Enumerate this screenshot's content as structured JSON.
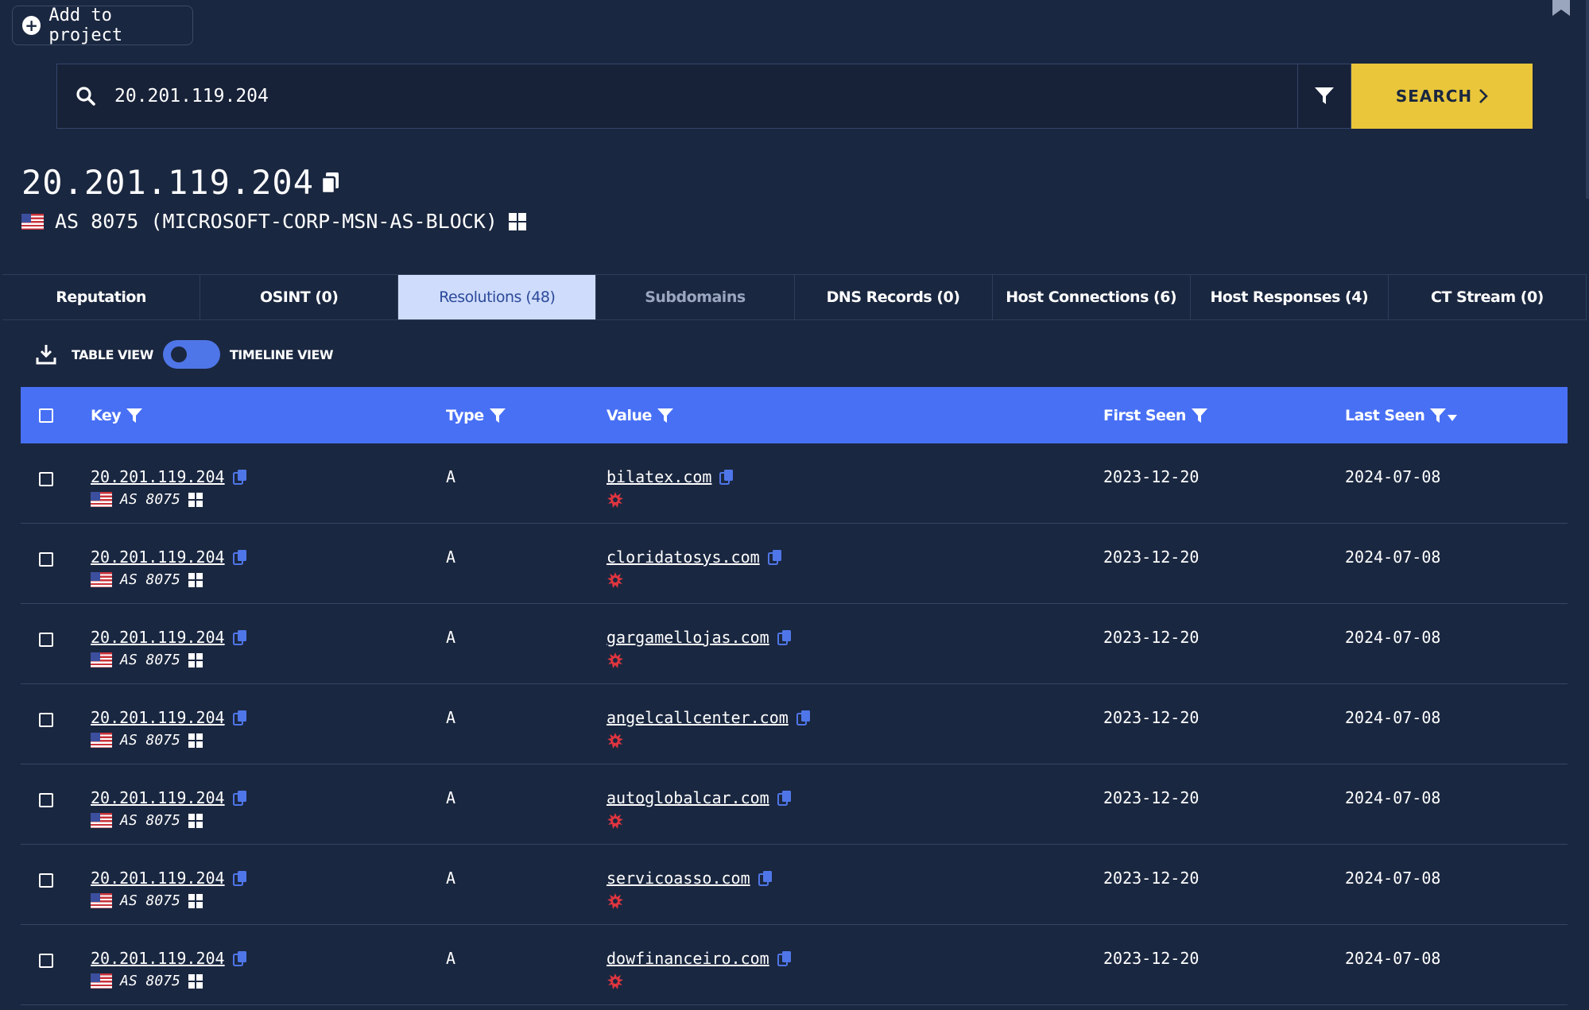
{
  "toolbar": {
    "add_to_project_label": "Add to project"
  },
  "search": {
    "value": "20.201.119.204",
    "button_label": "SEARCH"
  },
  "header": {
    "ip": "20.201.119.204",
    "as_label": "AS 8075 (MICROSOFT-CORP-MSN-AS-BLOCK)"
  },
  "tabs": [
    {
      "label": "Reputation",
      "state": "normal"
    },
    {
      "label": "OSINT (0)",
      "state": "normal"
    },
    {
      "label": "Resolutions (48)",
      "state": "active"
    },
    {
      "label": "Subdomains",
      "state": "disabled"
    },
    {
      "label": "DNS Records (0)",
      "state": "normal"
    },
    {
      "label": "Host Connections (6)",
      "state": "normal"
    },
    {
      "label": "Host Responses (4)",
      "state": "normal"
    },
    {
      "label": "CT Stream (0)",
      "state": "normal"
    }
  ],
  "view": {
    "table_label": "TABLE VIEW",
    "timeline_label": "TIMELINE VIEW"
  },
  "table": {
    "headers": {
      "key": "Key",
      "type": "Type",
      "value": "Value",
      "first_seen": "First Seen",
      "last_seen": "Last Seen"
    },
    "rows": [
      {
        "key": "20.201.119.204",
        "asn": "AS 8075",
        "type": "A",
        "value": "bilatex.com",
        "first_seen": "2023-12-20",
        "last_seen": "2024-07-08"
      },
      {
        "key": "20.201.119.204",
        "asn": "AS 8075",
        "type": "A",
        "value": "cloridatosys.com",
        "first_seen": "2023-12-20",
        "last_seen": "2024-07-08"
      },
      {
        "key": "20.201.119.204",
        "asn": "AS 8075",
        "type": "A",
        "value": "gargamellojas.com",
        "first_seen": "2023-12-20",
        "last_seen": "2024-07-08"
      },
      {
        "key": "20.201.119.204",
        "asn": "AS 8075",
        "type": "A",
        "value": "angelcallcenter.com",
        "first_seen": "2023-12-20",
        "last_seen": "2024-07-08"
      },
      {
        "key": "20.201.119.204",
        "asn": "AS 8075",
        "type": "A",
        "value": "autoglobalcar.com",
        "first_seen": "2023-12-20",
        "last_seen": "2024-07-08"
      },
      {
        "key": "20.201.119.204",
        "asn": "AS 8075",
        "type": "A",
        "value": "servicoasso.com",
        "first_seen": "2023-12-20",
        "last_seen": "2024-07-08"
      },
      {
        "key": "20.201.119.204",
        "asn": "AS 8075",
        "type": "A",
        "value": "dowfinanceiro.com",
        "first_seen": "2023-12-20",
        "last_seen": "2024-07-08"
      }
    ]
  },
  "colors": {
    "background": "#1a2740",
    "accent_blue": "#4870f5",
    "search_yellow": "#e9c63a",
    "malicious_red": "#e0353f"
  }
}
